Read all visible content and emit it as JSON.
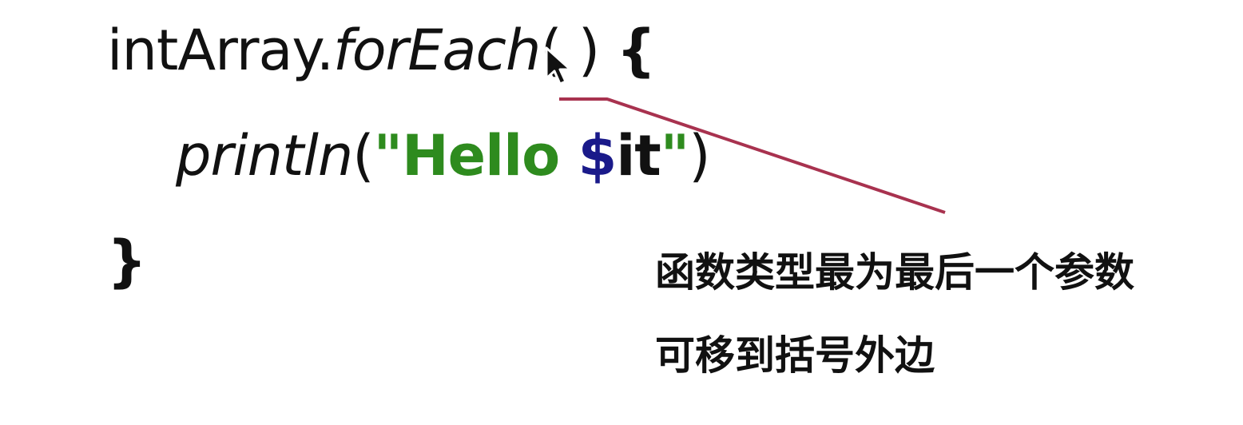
{
  "code": {
    "line1": {
      "receiver": "intArray.",
      "method": "forEach",
      "parens": "( )",
      "open_brace": "{"
    },
    "line2": {
      "call": "println",
      "open_paren": "(",
      "string_open": "\"Hello ",
      "template_sign": "$",
      "template_var": "it",
      "string_close": "\"",
      "close_paren": ")"
    },
    "line3": {
      "close_brace": "}"
    }
  },
  "annotation": {
    "line1": "函数类型最为最后一个参数",
    "line2": "可移到括号外边",
    "line_color": "#a8324f"
  },
  "colors": {
    "string": "#2e8b1e",
    "template": "#1a1a8a",
    "text": "#111111"
  },
  "icons": {
    "cursor": "mouse-pointer-icon"
  }
}
